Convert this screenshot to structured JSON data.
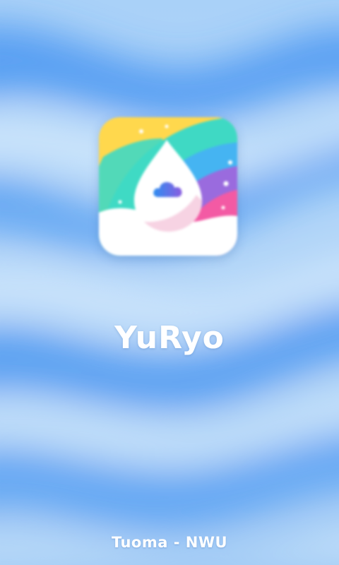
{
  "splash": {
    "app_name": "YuRyo",
    "footer_credit": "Tuoma - NWU"
  },
  "icons": {
    "app_icon": "app-logo-icon",
    "cloud": "cloud-icon"
  },
  "colors": {
    "background_light": "#b7daf9",
    "background_dark": "#3f8ff0",
    "text": "#ffffff",
    "icon_yellow": "#ffd84d",
    "icon_teal": "#3fd9c4",
    "icon_blue": "#45b4f2",
    "icon_purple": "#9a6bde",
    "icon_pink": "#f35aa4"
  }
}
